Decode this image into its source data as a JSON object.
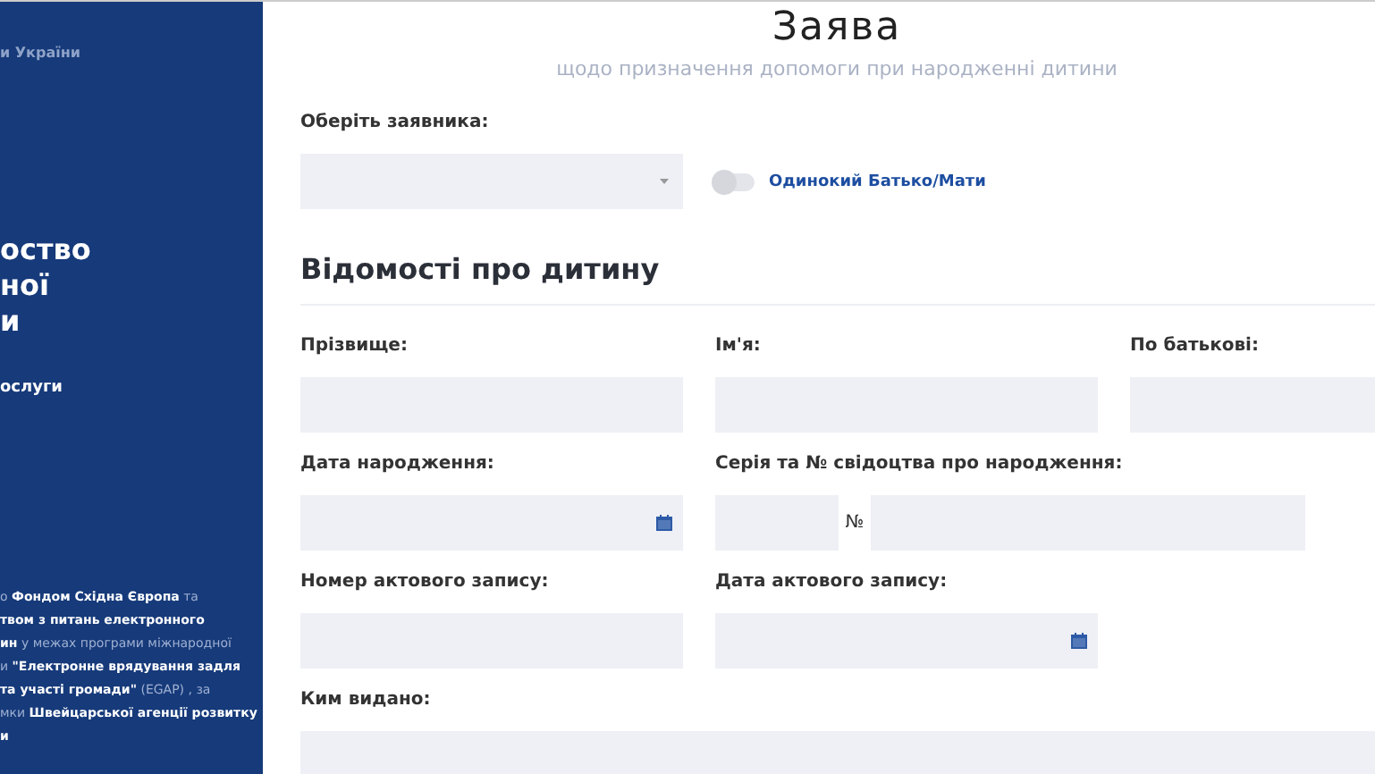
{
  "sidebar": {
    "org": "и України",
    "title_lines": [
      "оство",
      "ної",
      "и"
    ],
    "subtitle": "ослуги",
    "footer_lines": [
      "о **Фондом Східна Європа** та",
      "**твом з питань електронного**",
      "**ин** у межах програми міжнародної",
      "и **\"Електронне врядування задля**",
      "**та участі громади\"** (EGAP) , за",
      "мки **Швейцарської агенції розвитку**",
      "**и**"
    ]
  },
  "header": {
    "title": "Заява",
    "subtitle": "щодо призначення допомоги при народженні дитини"
  },
  "applicant": {
    "label": "Оберіть заявника:",
    "toggle_label": "Одинокий Батько/Мати",
    "toggle_on": false
  },
  "section": {
    "title": "Відомості про дитину"
  },
  "rows": [
    {
      "fields": [
        {
          "kind": "text",
          "label": "Прізвище:"
        },
        {
          "kind": "text",
          "label": "Ім'я:"
        },
        {
          "kind": "text",
          "label": "По батькові:"
        }
      ]
    },
    {
      "fields": [
        {
          "kind": "date",
          "label": "Дата народження:"
        },
        {
          "kind": "certificate",
          "label": "Серія та № свідоцтва про народження:",
          "sign": "№"
        }
      ]
    },
    {
      "fields": [
        {
          "kind": "text",
          "label": "Номер актового запису:"
        },
        {
          "kind": "date",
          "label": "Дата актового запису:"
        }
      ]
    },
    {
      "fields": [
        {
          "kind": "wide",
          "label": "Ким видано:"
        }
      ]
    }
  ]
}
